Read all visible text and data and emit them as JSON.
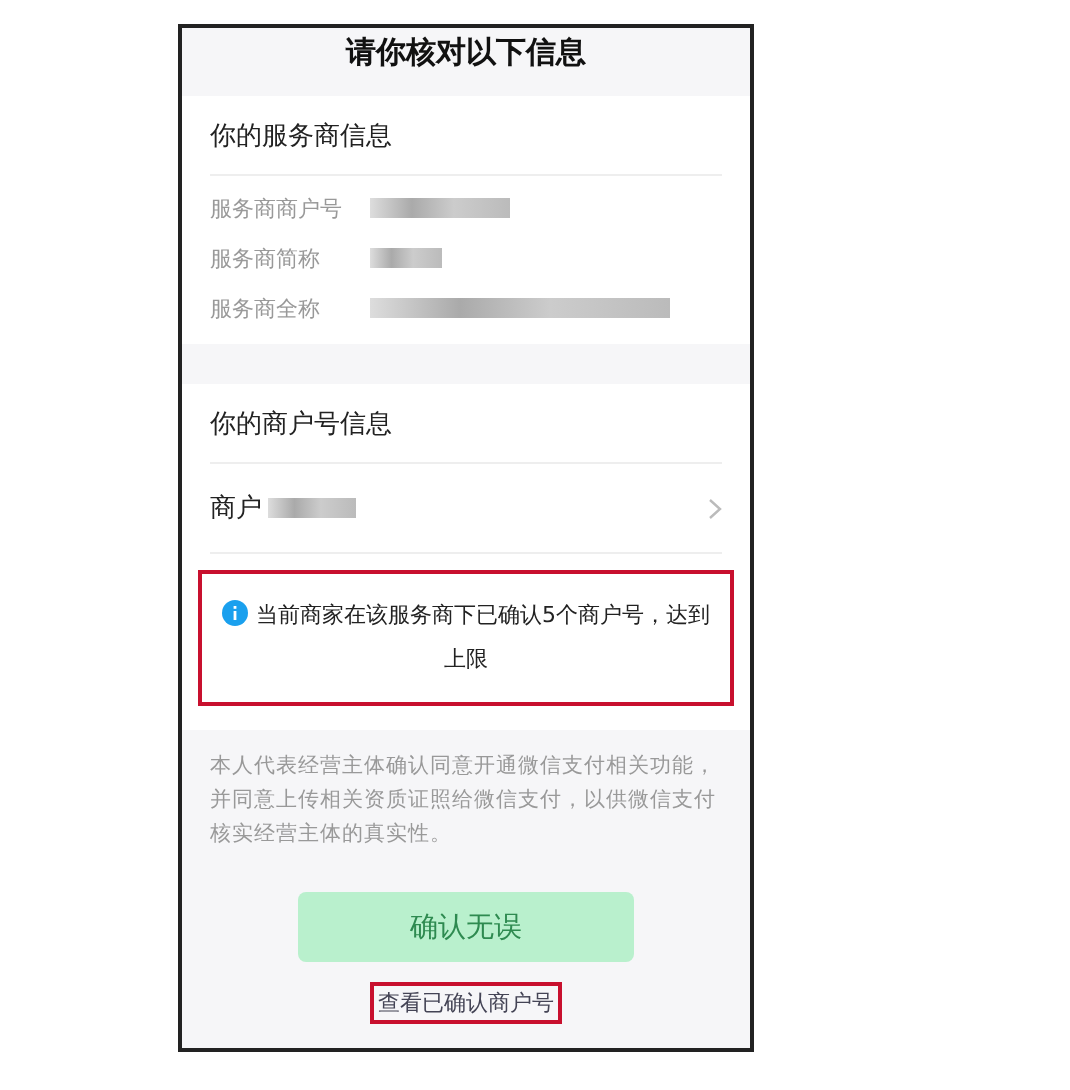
{
  "title": "请你核对以下信息",
  "provider_section": {
    "heading": "你的服务商信息",
    "rows": [
      {
        "label": "服务商商户号"
      },
      {
        "label": "服务商简称"
      },
      {
        "label": "服务商全称"
      }
    ]
  },
  "merchant_section": {
    "heading": "你的商户号信息",
    "merchant": {
      "label": "商户"
    }
  },
  "notice": {
    "text": "当前商家在该服务商下已确认5个商户号，达到上限",
    "highlighted": true
  },
  "disclaimer": "本人代表经营主体确认同意开通微信支付相关功能，并同意上传相关资质证照给微信支付，以供微信支付核实经营主体的真实性。",
  "confirm_button": {
    "label": "确认无误",
    "disabled": true
  },
  "link": {
    "label": "查看已确认商户号",
    "highlighted": true
  }
}
